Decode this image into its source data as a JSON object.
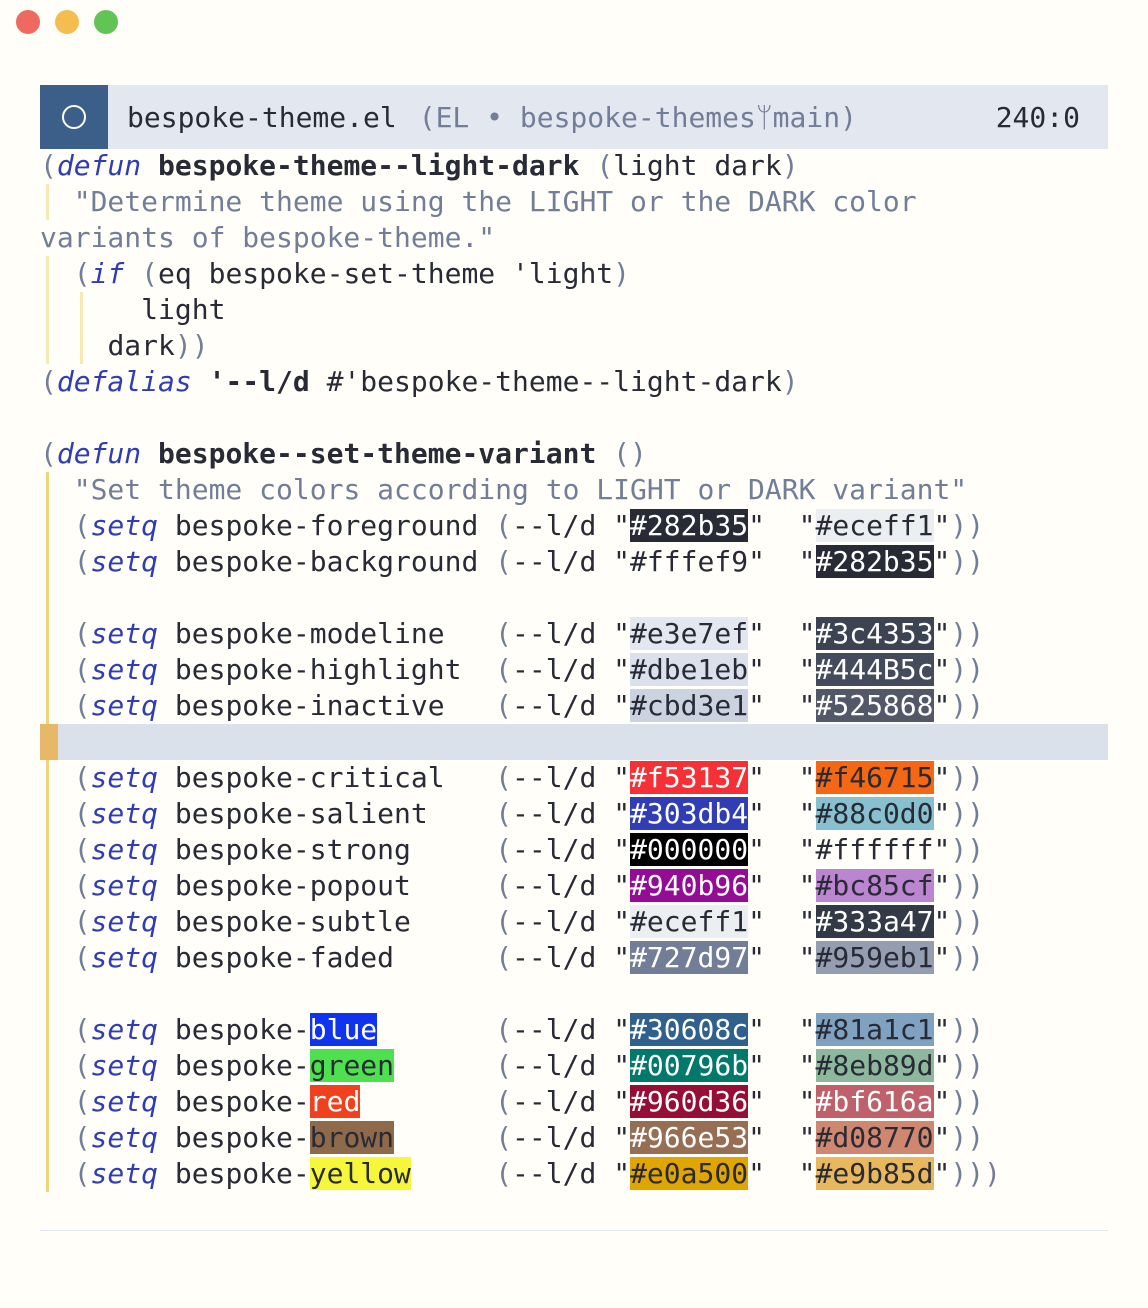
{
  "modeline": {
    "filename": "bespoke-theme.el",
    "meta": "(EL • bespoke-themesᛘmain)",
    "position": "240:0"
  },
  "code": {
    "l1_kw": "defun",
    "l1_name": "bespoke-theme--light-dark",
    "l1_args": "light dark",
    "l2_doc": "\"Determine theme using the LIGHT or the DARK color",
    "l3_doc": "variants of bespoke-theme.\"",
    "l4_kw": "if",
    "l4_txt": "eq bespoke-set-theme 'light",
    "l5_txt": "light",
    "l6_txt": "dark",
    "l7_kw": "defalias",
    "l7_quote": "'--l/d",
    "l7_rest": " #'bespoke-theme--light-dark",
    "l9_kw": "defun",
    "l9_name": "bespoke--set-theme-variant",
    "l9_args": "()",
    "l10_doc": "\"Set theme colors according to LIGHT or DARK variant\"",
    "setq": "setq",
    "ld": "--l/d",
    "close2": "))",
    "close3": ")))",
    "prefix": "bespoke-"
  },
  "colors": [
    {
      "name": "bespoke-foreground",
      "light": "#282b35",
      "dark": "#eceff1",
      "lbg": "#282b35",
      "lfg": "#ffffff",
      "dbg": "#eceff1",
      "dfg": "#282b35"
    },
    {
      "name": "bespoke-background",
      "light": "#fffef9",
      "dark": "#282b35",
      "lbg": "transparent",
      "lfg": "#282b35",
      "dbg": "#282b35",
      "dfg": "#ffffff"
    },
    {
      "name": "bespoke-modeline",
      "light": "#e3e7ef",
      "dark": "#3c4353",
      "lbg": "#e3e7ef",
      "lfg": "#282b35",
      "dbg": "#3c4353",
      "dfg": "#ffffff"
    },
    {
      "name": "bespoke-highlight",
      "light": "#dbe1eb",
      "dark": "#444B5c",
      "lbg": "#dbe1eb",
      "lfg": "#282b35",
      "dbg": "#444b5c",
      "dfg": "#ffffff"
    },
    {
      "name": "bespoke-inactive",
      "light": "#cbd3e1",
      "dark": "#525868",
      "lbg": "#cbd3e1",
      "lfg": "#282b35",
      "dbg": "#525868",
      "dfg": "#ffffff"
    },
    {
      "name": "bespoke-critical",
      "light": "#f53137",
      "dark": "#f46715",
      "lbg": "#f53137",
      "lfg": "#ffffff",
      "dbg": "#f46715",
      "dfg": "#282b35"
    },
    {
      "name": "bespoke-salient",
      "light": "#303db4",
      "dark": "#88c0d0",
      "lbg": "#303db4",
      "lfg": "#ffffff",
      "dbg": "#88c0d0",
      "dfg": "#282b35"
    },
    {
      "name": "bespoke-strong",
      "light": "#000000",
      "dark": "#ffffff",
      "lbg": "#000000",
      "lfg": "#ffffff",
      "dbg": "transparent",
      "dfg": "#282b35"
    },
    {
      "name": "bespoke-popout",
      "light": "#940b96",
      "dark": "#bc85cf",
      "lbg": "#940b96",
      "lfg": "#ffffff",
      "dbg": "#bc85cf",
      "dfg": "#282b35"
    },
    {
      "name": "bespoke-subtle",
      "light": "#eceff1",
      "dark": "#333a47",
      "lbg": "#eceff1",
      "lfg": "#282b35",
      "dbg": "#333a47",
      "dfg": "#ffffff"
    },
    {
      "name": "bespoke-faded",
      "light": "#727d97",
      "dark": "#959eb1",
      "lbg": "#727d97",
      "lfg": "#ffffff",
      "dbg": "#959eb1",
      "dfg": "#282b35"
    },
    {
      "name": "blue",
      "light": "#30608c",
      "dark": "#81a1c1",
      "nbg": "#1034ee",
      "nfg": "#ffffff",
      "lbg": "#30608c",
      "lfg": "#ffffff",
      "dbg": "#81a1c1",
      "dfg": "#282b35"
    },
    {
      "name": "green",
      "light": "#00796b",
      "dark": "#8eb89d",
      "nbg": "#4ee04e",
      "nfg": "#282b35",
      "lbg": "#00796b",
      "lfg": "#ffffff",
      "dbg": "#8eb89d",
      "dfg": "#282b35"
    },
    {
      "name": "red",
      "light": "#960d36",
      "dark": "#bf616a",
      "nbg": "#f0401d",
      "nfg": "#ffffff",
      "lbg": "#960d36",
      "lfg": "#ffffff",
      "dbg": "#bf616a",
      "dfg": "#ffffff"
    },
    {
      "name": "brown",
      "light": "#966e53",
      "dark": "#d08770",
      "nbg": "#8e6a4a",
      "nfg": "#282b35",
      "lbg": "#966e53",
      "lfg": "#ffffff",
      "dbg": "#d08770",
      "dfg": "#282b35"
    },
    {
      "name": "yellow",
      "light": "#e0a500",
      "dark": "#e9b85d",
      "nbg": "#f6f63a",
      "nfg": "#282b35",
      "lbg": "#e0a500",
      "lfg": "#282b35",
      "dbg": "#e9b85d",
      "dfg": "#282b35"
    }
  ]
}
